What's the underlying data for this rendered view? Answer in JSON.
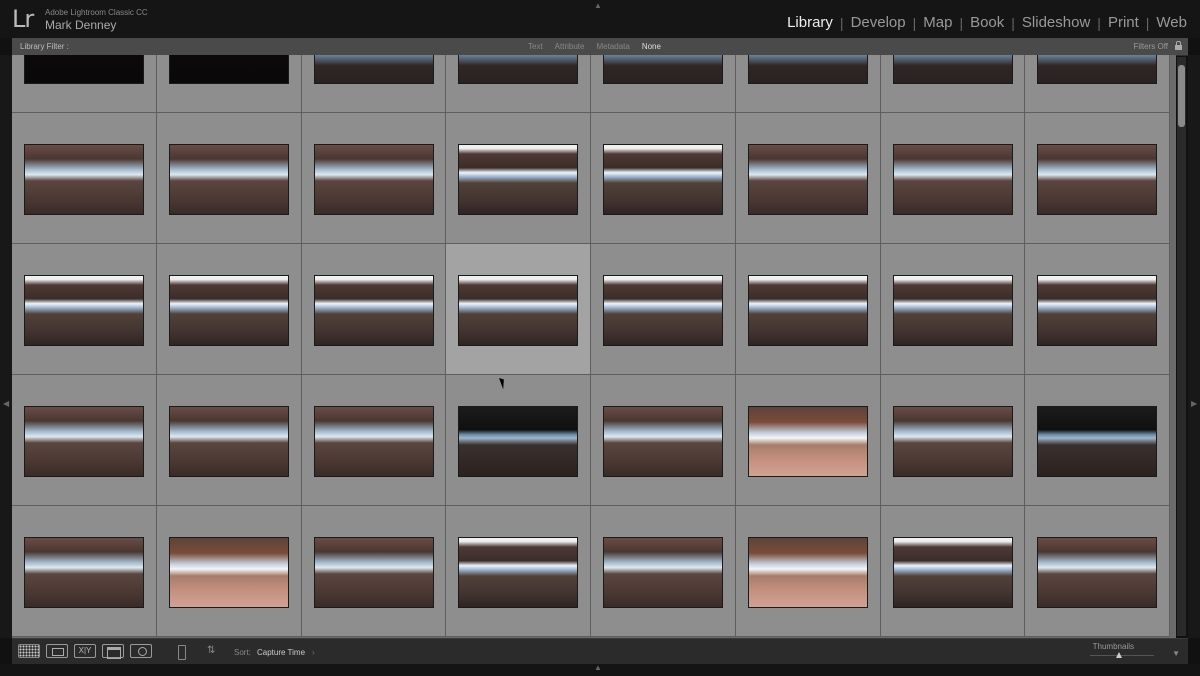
{
  "app": {
    "logo": "Lr",
    "name": "Adobe Lightroom Classic CC",
    "user": "Mark Denney"
  },
  "modules": [
    "Library",
    "Develop",
    "Map",
    "Book",
    "Slideshow",
    "Print",
    "Web"
  ],
  "active_module": "Library",
  "filter_bar": {
    "title": "Library Filter :",
    "options": [
      "Text",
      "Attribute",
      "Metadata",
      "None"
    ],
    "selected": "None",
    "status": "Filters Off"
  },
  "grid": {
    "columns": 8,
    "selected_row": 2,
    "selected_col": 3,
    "rows": [
      [
        "e",
        "e",
        "f",
        "f",
        "f",
        "f",
        "f",
        "f"
      ],
      [
        "a",
        "a",
        "a",
        "b",
        "b",
        "a",
        "a",
        "a"
      ],
      [
        "b",
        "b",
        "b",
        "b",
        "b",
        "b",
        "b",
        "b"
      ],
      [
        "a",
        "a",
        "a",
        "c",
        "a",
        "d",
        "a",
        "c"
      ],
      [
        "a",
        "d",
        "a",
        "b",
        "a",
        "d",
        "b",
        "a"
      ]
    ]
  },
  "toolbar": {
    "compare_glyph": "X|Y",
    "sort_label": "Sort:",
    "sort_value": "Capture Time",
    "thumbnails_label": "Thumbnails",
    "thumbnail_size": 0.45
  },
  "colors": {
    "cell": "#8e8e8e",
    "cell_selected": "#a3a3a3",
    "active_module": "#eeeeee"
  }
}
